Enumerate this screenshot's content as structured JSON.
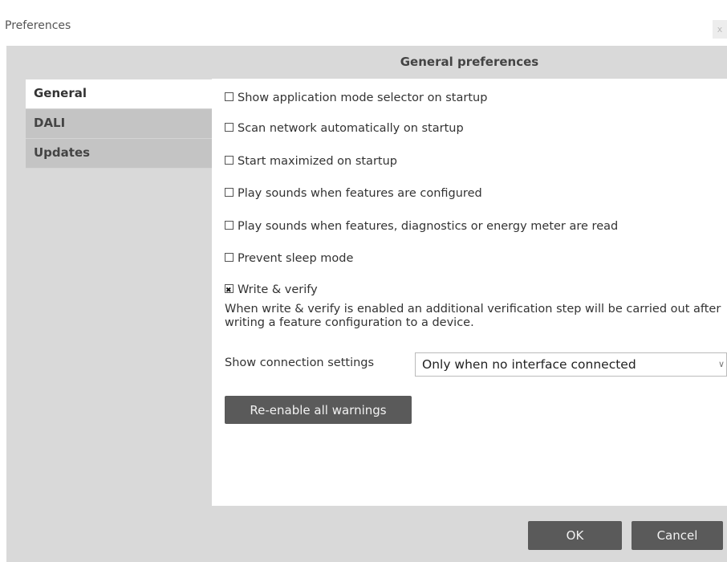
{
  "window": {
    "title": "Preferences",
    "corner_mark": "ʹ"
  },
  "section_title": "General preferences",
  "sidebar": {
    "items": [
      {
        "label": "General",
        "active": true
      },
      {
        "label": "DALI",
        "active": false
      },
      {
        "label": "Updates",
        "active": false
      }
    ]
  },
  "options": [
    {
      "label": "Show application mode selector on startup",
      "checked": false
    },
    {
      "label": "Scan network automatically on startup",
      "checked": false
    },
    {
      "label": "Start maximized on startup",
      "checked": false
    },
    {
      "label": "Play sounds when features are configured",
      "checked": false
    },
    {
      "label": "Play sounds when features, diagnostics or energy meter are read",
      "checked": false
    },
    {
      "label": "Prevent sleep mode",
      "checked": false
    },
    {
      "label": "Write & verify",
      "checked": true
    }
  ],
  "write_verify_note": "When write & verify is enabled an additional verification step will be carried out after writing a feature configuration to a device.",
  "connection": {
    "label": "Show connection settings",
    "selected": "Only when no interface connected"
  },
  "buttons": {
    "reenable_warnings": "Re-enable all warnings",
    "ok": "OK",
    "cancel": "Cancel",
    "close": "x"
  },
  "icons": {
    "checkbox_checked": "checkbox-checked-icon",
    "checkbox_unchecked": "checkbox-unchecked-icon",
    "dropdown": "chevron-down-icon"
  },
  "colors": {
    "dialog_background": "#d9d9d9",
    "sidebar_inactive": "#c4c4c4",
    "button_background": "#5a5a5a",
    "button_text": "#f2f2f2"
  }
}
